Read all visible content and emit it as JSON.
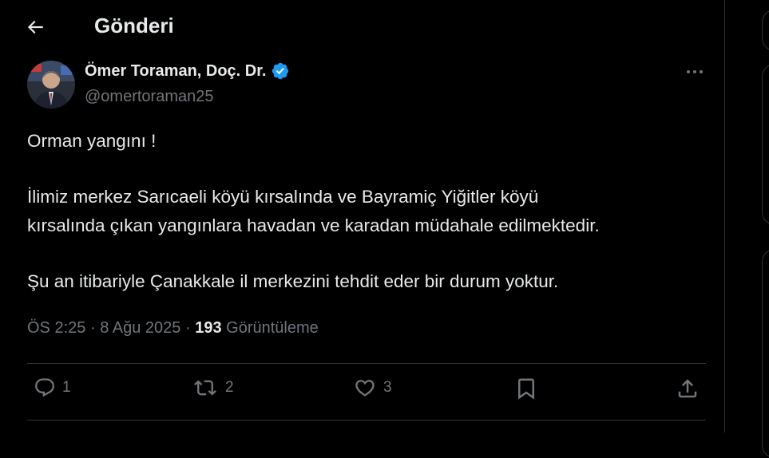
{
  "header": {
    "title": "Gönderi"
  },
  "author": {
    "name": "Ömer Toraman, Doç. Dr.",
    "handle": "@omertoraman25"
  },
  "tweet": {
    "paragraphs": [
      [
        "Orman yangını !"
      ],
      [
        "İlimiz merkez Sarıcaeli köyü kırsalında ve Bayramiç Yiğitler köyü",
        "kırsalında çıkan yangınlara havadan ve karadan müdahale edilmektedir."
      ],
      [
        "Şu an itibariyle Çanakkale il merkezini tehdit eder bir durum yoktur."
      ]
    ]
  },
  "meta": {
    "time": "ÖS 2:25",
    "sep": "·",
    "date": "8 Ağu 2025",
    "views": "193",
    "views_label": "Görüntüleme"
  },
  "actions": {
    "reply_count": "1",
    "repost_count": "2",
    "like_count": "3"
  },
  "colors": {
    "background": "#000000",
    "text": "#e7e9ea",
    "muted": "#71767b",
    "verified": "#1d9bf0",
    "border": "#2f3336"
  },
  "icons": [
    "back-arrow-icon",
    "verified-badge-icon",
    "more-icon",
    "reply-icon",
    "repost-icon",
    "like-icon",
    "bookmark-icon",
    "share-icon"
  ]
}
